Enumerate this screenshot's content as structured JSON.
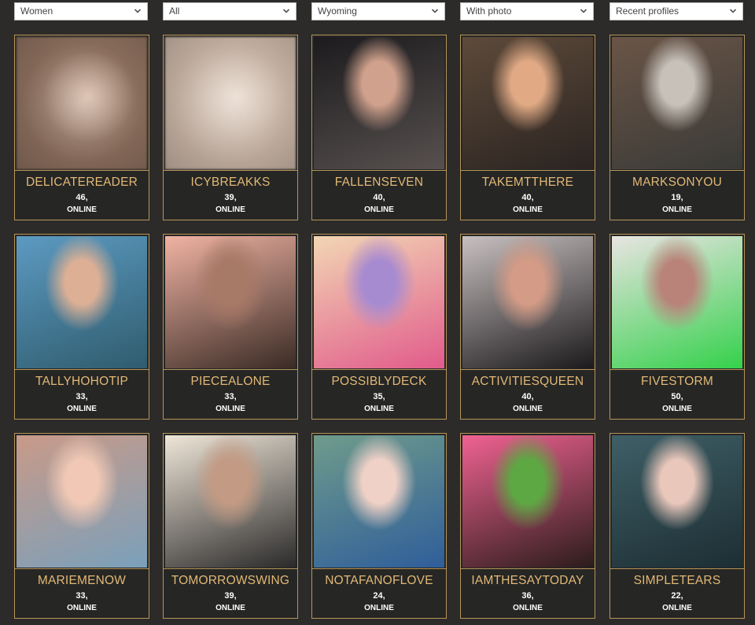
{
  "filters": {
    "gender": "Women",
    "category": "All",
    "location": "Wyoming",
    "photo": "With photo",
    "sort": "Recent profiles"
  },
  "profiles": [
    {
      "username": "DELICATEREADER",
      "age": "46,",
      "status": "ONLINE",
      "photo_colors": [
        "#8a6d5c",
        "#d6b7a3",
        "#6f584b"
      ],
      "blurred": true
    },
    {
      "username": "ICYBREAKKS",
      "age": "39,",
      "status": "ONLINE",
      "photo_colors": [
        "#c3b0a2",
        "#e8d8cb",
        "#9f8e82"
      ],
      "blurred": true
    },
    {
      "username": "FALLENSEVEN",
      "age": "40,",
      "status": "ONLINE",
      "photo_colors": [
        "#1c1b1d",
        "#d0a18c",
        "#57504f"
      ],
      "blurred": false
    },
    {
      "username": "TAKEMTTHERE",
      "age": "40,",
      "status": "ONLINE",
      "photo_colors": [
        "#5d4a3a",
        "#e1aa85",
        "#2b2421"
      ],
      "blurred": false
    },
    {
      "username": "MARKSONYOU",
      "age": "19,",
      "status": "ONLINE",
      "photo_colors": [
        "#6a5547",
        "#c7c1ba",
        "#3a3a37"
      ],
      "blurred": false
    },
    {
      "username": "TALLYHOHOTIP",
      "age": "33,",
      "status": "ONLINE",
      "photo_colors": [
        "#5c9ac1",
        "#ddb095",
        "#2f5c6e"
      ],
      "blurred": false
    },
    {
      "username": "PIECEALONE",
      "age": "33,",
      "status": "ONLINE",
      "photo_colors": [
        "#f0b3a3",
        "#a77967",
        "#3a2b25"
      ],
      "blurred": false
    },
    {
      "username": "POSSIBLYDECK",
      "age": "35,",
      "status": "ONLINE",
      "photo_colors": [
        "#f2d6b4",
        "#a78bd1",
        "#e15b8b"
      ],
      "blurred": false
    },
    {
      "username": "ACTIVITIESQUEEN",
      "age": "40,",
      "status": "ONLINE",
      "photo_colors": [
        "#c8c0c0",
        "#d49b86",
        "#1c1a1c"
      ],
      "blurred": false
    },
    {
      "username": "FIVESTORM",
      "age": "50,",
      "status": "ONLINE",
      "photo_colors": [
        "#e9e4e2",
        "#b9837a",
        "#34d14b"
      ],
      "blurred": false
    },
    {
      "username": "MARIEMENOW",
      "age": "33,",
      "status": "ONLINE",
      "photo_colors": [
        "#c99a88",
        "#f0c8b5",
        "#7aa0bb"
      ],
      "blurred": false
    },
    {
      "username": "TOMORROWSWING",
      "age": "39,",
      "status": "ONLINE",
      "photo_colors": [
        "#efe6d8",
        "#c39a83",
        "#2b2a2a"
      ],
      "blurred": false
    },
    {
      "username": "NOTAFANOFLOVE",
      "age": "24,",
      "status": "ONLINE",
      "photo_colors": [
        "#6f9b8b",
        "#f0d1c7",
        "#2f5e9a"
      ],
      "blurred": false
    },
    {
      "username": "IAMTHESAYTODAY",
      "age": "36,",
      "status": "ONLINE",
      "photo_colors": [
        "#f06292",
        "#5ea843",
        "#2b1c1b"
      ],
      "blurred": false
    },
    {
      "username": "SIMPLETEARS",
      "age": "22,",
      "status": "ONLINE",
      "photo_colors": [
        "#3f5f67",
        "#e9c7bb",
        "#1c2e33"
      ],
      "blurred": false
    }
  ],
  "icons": {
    "dropdown": "chevron-down-icon"
  }
}
